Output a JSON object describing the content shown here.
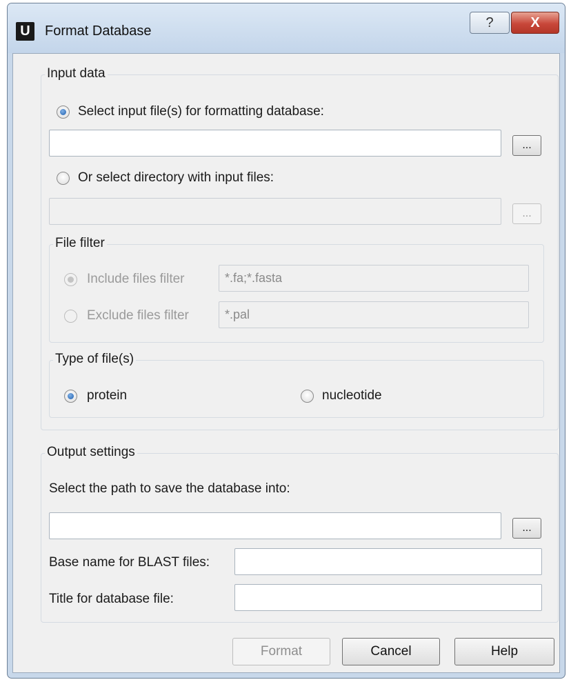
{
  "window": {
    "title": "Format Database",
    "app_icon_letter": "U",
    "help_glyph": "?",
    "close_glyph": "X"
  },
  "input_data": {
    "legend": "Input data",
    "select_files_label": "Select input file(s) for formatting database:",
    "input_files_value": "",
    "browse_files_label": "...",
    "select_dir_label": "Or select directory with input files:",
    "input_dir_value": "",
    "browse_dir_label": "...",
    "file_filter": {
      "legend": "File filter",
      "include_label": "Include files filter",
      "include_value": "*.fa;*.fasta",
      "exclude_label": "Exclude files filter",
      "exclude_value": "*.pal"
    },
    "file_type": {
      "legend": "Type of file(s)",
      "protein_label": "protein",
      "nucleotide_label": "nucleotide"
    }
  },
  "output_settings": {
    "legend": "Output settings",
    "path_label": "Select the path to save the database into:",
    "path_value": "",
    "browse_path_label": "...",
    "base_name_label": "Base name for BLAST files:",
    "base_name_value": "",
    "title_label": "Title for database file:",
    "title_value": ""
  },
  "buttons": {
    "format": "Format",
    "cancel": "Cancel",
    "help": "Help"
  }
}
